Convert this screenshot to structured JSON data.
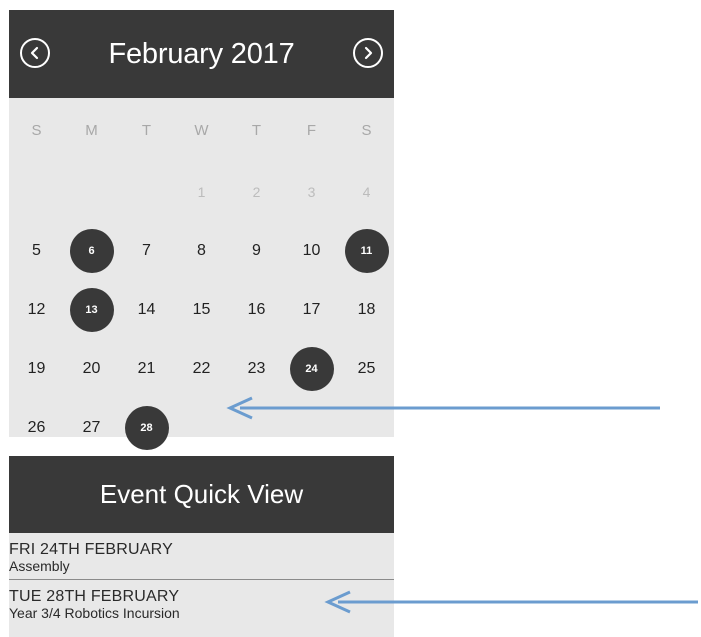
{
  "calendar": {
    "title": "February 2017",
    "weekdays": [
      "S",
      "M",
      "T",
      "W",
      "T",
      "F",
      "S"
    ],
    "days": [
      "",
      "",
      "",
      "1",
      "2",
      "3",
      "4",
      "5",
      "6",
      "7",
      "8",
      "9",
      "10",
      "11",
      "12",
      "13",
      "14",
      "15",
      "16",
      "17",
      "18",
      "19",
      "20",
      "21",
      "22",
      "23",
      "24",
      "25",
      "26",
      "27",
      "28",
      "",
      "",
      "",
      ""
    ],
    "muted_days": [
      "1",
      "2",
      "3",
      "4"
    ],
    "event_days": [
      "6",
      "11",
      "13",
      "24",
      "28"
    ],
    "prev_icon": "chevron-left-circle-icon",
    "next_icon": "chevron-right-circle-icon"
  },
  "quick_view": {
    "title": "Event Quick View",
    "events": [
      {
        "date": "FRI 24TH FEBRUARY",
        "title": "Assembly"
      },
      {
        "date": "TUE 28TH FEBRUARY",
        "title": "Year 3/4 Robotics Incursion"
      }
    ]
  },
  "colors": {
    "header_bg": "#393939",
    "panel_bg": "#e8e8e8",
    "arrow": "#6b9ccf"
  }
}
